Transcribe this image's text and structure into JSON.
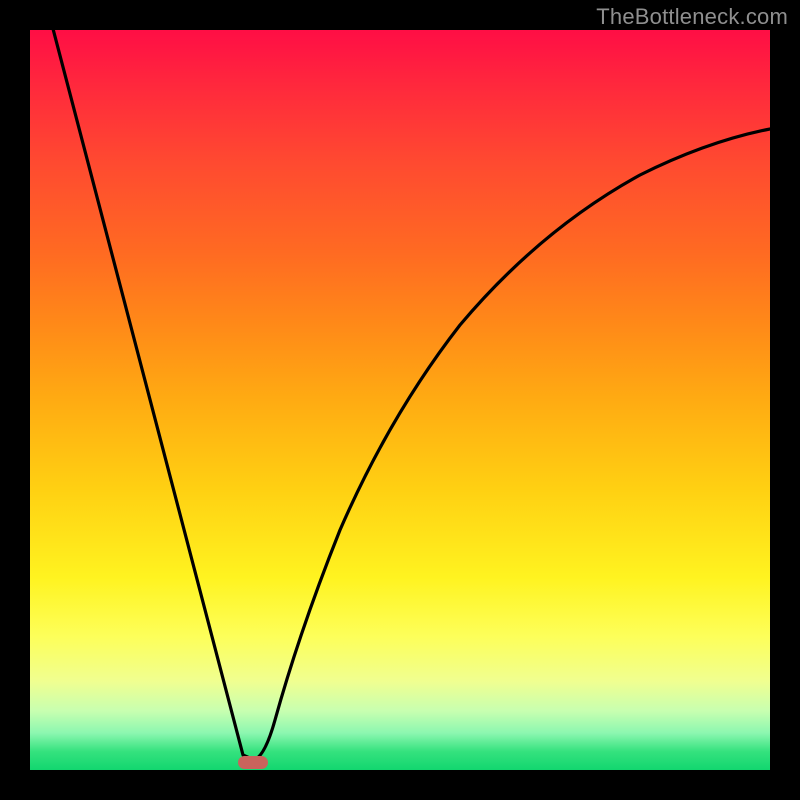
{
  "watermark": "TheBottleneck.com",
  "chart_data": {
    "type": "line",
    "title": "",
    "xlabel": "",
    "ylabel": "",
    "xlim": [
      0,
      100
    ],
    "ylim": [
      0,
      100
    ],
    "grid": false,
    "legend": false,
    "background": "vertical gradient red→orange→yellow→green",
    "series": [
      {
        "name": "left-branch",
        "x": [
          3,
          6,
          9,
          12,
          15,
          18,
          21,
          24,
          27,
          29,
          30
        ],
        "y": [
          100,
          89,
          78,
          67,
          56,
          45,
          33,
          22,
          11,
          3,
          0
        ]
      },
      {
        "name": "right-branch",
        "x": [
          30,
          31,
          33,
          36,
          40,
          45,
          50,
          55,
          60,
          65,
          70,
          75,
          80,
          85,
          90,
          95,
          100
        ],
        "y": [
          0,
          5,
          14,
          25,
          36,
          47,
          55,
          62,
          67,
          71,
          75,
          78,
          80,
          82,
          84,
          85.5,
          87
        ]
      }
    ],
    "marker": {
      "name": "minimum-marker",
      "x": 30,
      "y": 0,
      "color": "#c9635c",
      "shape": "rounded-horizontal"
    }
  }
}
